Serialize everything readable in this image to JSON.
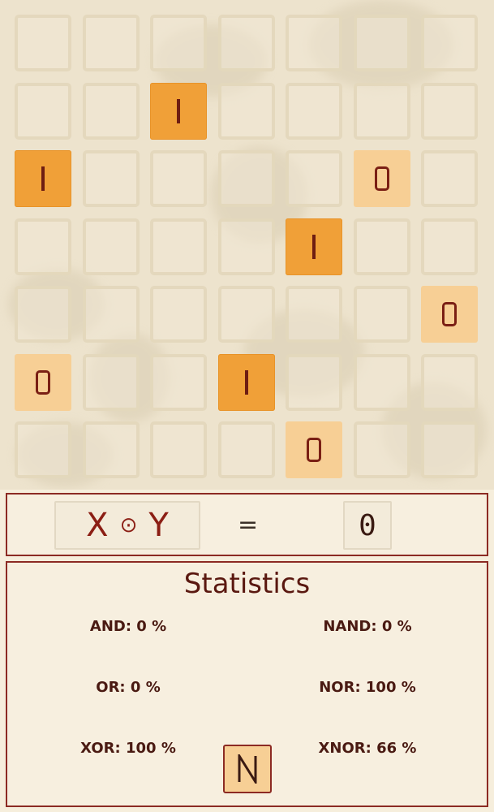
{
  "board": {
    "rows": 7,
    "cols": 7,
    "tiles": [
      {
        "row": 1,
        "col": 2,
        "value": "1"
      },
      {
        "row": 2,
        "col": 0,
        "value": "1"
      },
      {
        "row": 2,
        "col": 5,
        "value": "0"
      },
      {
        "row": 3,
        "col": 4,
        "value": "1"
      },
      {
        "row": 4,
        "col": 6,
        "value": "0"
      },
      {
        "row": 5,
        "col": 0,
        "value": "0"
      },
      {
        "row": 5,
        "col": 3,
        "value": "1"
      },
      {
        "row": 6,
        "col": 4,
        "value": "0"
      }
    ]
  },
  "formula": {
    "left_var": "X",
    "operator": "⊙",
    "right_var": "Y",
    "equals": "=",
    "result": "0"
  },
  "stats": {
    "title": "Statistics",
    "and": "AND: 0 %",
    "nand": "NAND: 0 %",
    "or": "OR: 0 %",
    "nor": "NOR: 100 %",
    "xor": "XOR: 100 %",
    "xnor": "XNOR: 66 %",
    "next_label": "N"
  },
  "colors": {
    "tile_one": "#f0a038",
    "tile_zero": "#f7cf95",
    "panel_border": "#8c2a23",
    "text": "#7a1f14"
  }
}
